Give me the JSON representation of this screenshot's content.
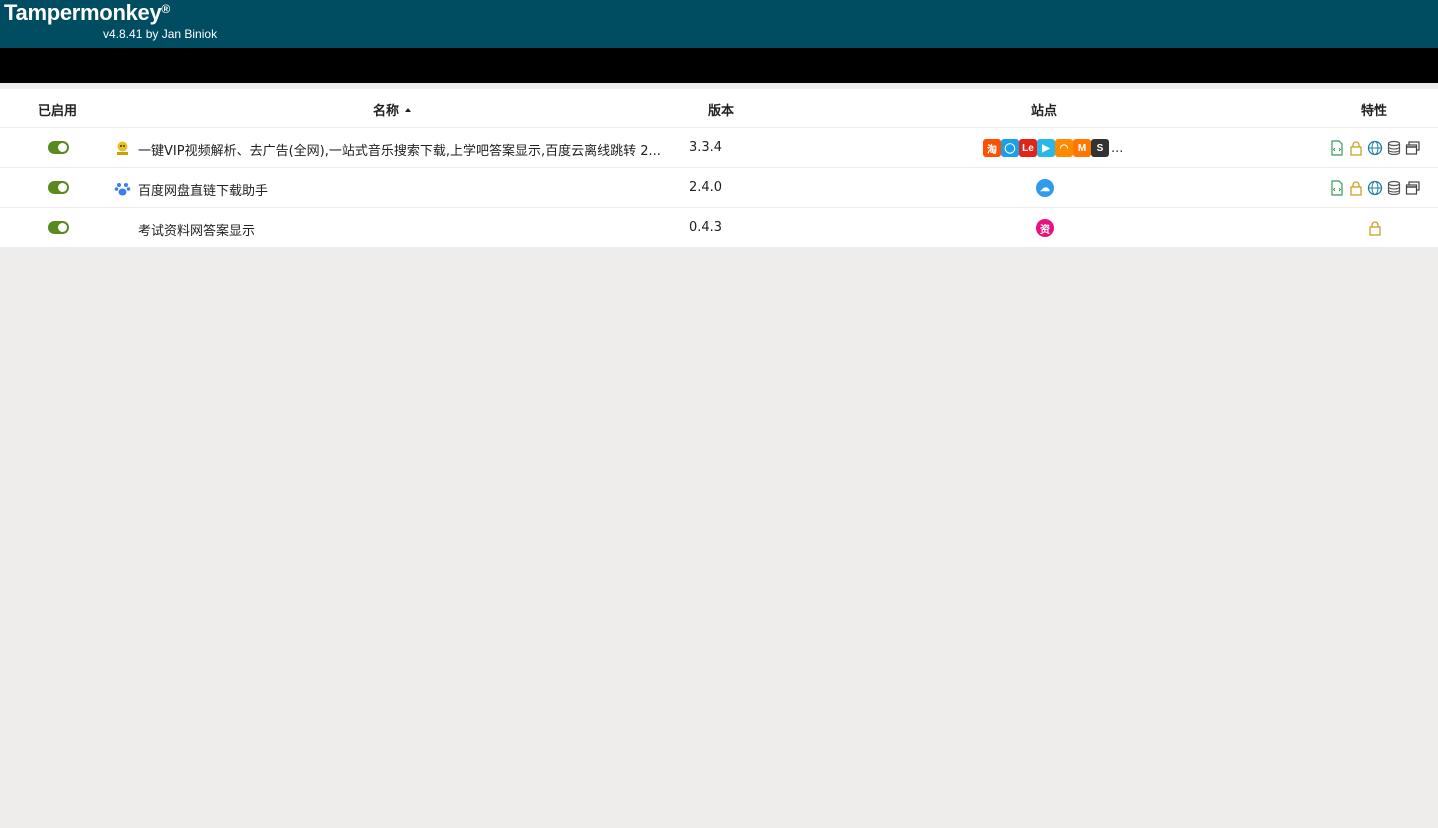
{
  "app": {
    "title": "Tampermonkey",
    "registered_mark": "®",
    "version_line": "v4.8.41 by Jan Biniok"
  },
  "table": {
    "headers": {
      "enabled": "已启用",
      "name": "名称",
      "version": "版本",
      "sites": "站点",
      "features": "特性"
    },
    "rows": [
      {
        "enabled": true,
        "name": "一键VIP视频解析、去广告(全网),一站式音乐搜索下载,上学吧答案显示,百度云离线跳转 2...",
        "version": "3.3.4",
        "icon": "gold-star-icon",
        "site_badges": [
          {
            "label": "淘",
            "color": "#ff5000"
          },
          {
            "label": "◯",
            "color": "#1aa0e8"
          },
          {
            "label": "Le",
            "color": "#e2231a"
          },
          {
            "label": "▶",
            "color": "#27b7e8"
          },
          {
            "label": "◠",
            "color": "#ff8a00"
          },
          {
            "label": "M",
            "color": "#ff7700"
          },
          {
            "label": "S",
            "color": "#333333"
          }
        ],
        "sites_more": "...",
        "features": [
          "script-file-icon",
          "lock-icon",
          "globe-icon",
          "database-icon",
          "windows-icon"
        ]
      },
      {
        "enabled": true,
        "name": "百度网盘直链下载助手",
        "version": "2.4.0",
        "icon": "baidu-paw-icon",
        "site_badges": [
          {
            "label": "☁",
            "color": "#2f9bec"
          }
        ],
        "sites_more": "",
        "features": [
          "script-file-icon",
          "lock-icon",
          "globe-icon",
          "database-icon",
          "windows-icon"
        ]
      },
      {
        "enabled": true,
        "name": "考试资料网答案显示",
        "version": "0.4.3",
        "icon": "",
        "site_badges": [
          {
            "label": "资",
            "color": "#e8127d"
          }
        ],
        "sites_more": "",
        "features": [
          "lock-icon"
        ]
      }
    ]
  },
  "colors": {
    "header_bg": "#004c61",
    "toolbar_bg": "#000000",
    "toggle_on": "#5a8a1e",
    "page_bg": "#eeedeb",
    "lock_color": "#c9a227",
    "file_color": "#3a9a5b",
    "globe_color": "#1f7ea8",
    "db_color": "#555555"
  }
}
